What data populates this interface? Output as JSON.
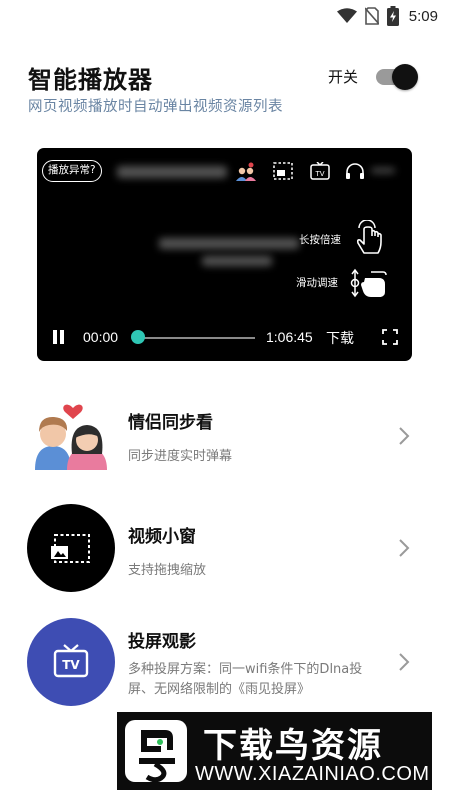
{
  "status_bar": {
    "time": "5:09",
    "icons": [
      "wifi-icon",
      "no-sim-icon",
      "battery-charging-icon"
    ]
  },
  "header": {
    "title": "智能播放器",
    "subtitle": "网页视频播放时自动弹出视频资源列表",
    "toggle_label": "开关",
    "toggle_on": true
  },
  "player": {
    "issue_button": "播放异常?",
    "long_press_hint": "长按倍速",
    "swipe_hint": "滑动调速",
    "current_time": "00:00",
    "total_time": "1:06:45",
    "download_label": "下载",
    "progress": 0,
    "accent_color": "#2fc6b4",
    "icons": [
      "couple-sync-icon",
      "mini-window-icon",
      "tv-cast-icon",
      "headphones-icon",
      "pause-icon",
      "fullscreen-icon",
      "tap-hand-icon",
      "swipe-hand-icon"
    ]
  },
  "features": [
    {
      "title": "情侣同步看",
      "description": "同步进度实时弹幕",
      "icon": "couple-icon"
    },
    {
      "title": "视频小窗",
      "description": "支持拖拽缩放",
      "icon": "mini-window-icon"
    },
    {
      "title": "投屏观影",
      "description": "多种投屏方案：同一wifi条件下的Dlna投屏、无网络限制的《雨见投屏》",
      "icon": "tv-cast-icon"
    }
  ],
  "colors": {
    "subtitle": "#6a85a3",
    "cast_circle": "#3e4db3",
    "window_circle": "#000000"
  },
  "watermark": {
    "name": "下载鸟资源",
    "url": "WWW.XIAZAINIAO.COM"
  }
}
